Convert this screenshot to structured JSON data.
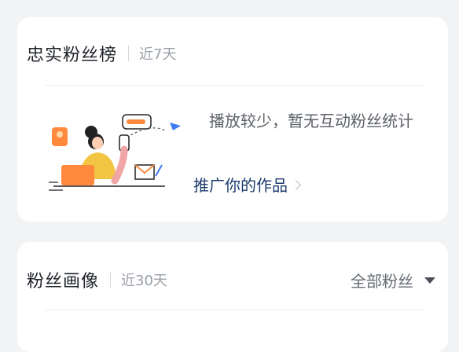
{
  "loyal_fans": {
    "title": "忠实粉丝榜",
    "period": "近7天",
    "empty_message": "播放较少，暂无互动粉丝统计",
    "promote_link": "推广你的作品"
  },
  "fan_profile": {
    "title": "粉丝画像",
    "period": "近30天",
    "filter_selected": "全部粉丝"
  },
  "icons": {
    "promote_chevron": "chevron-right-icon",
    "filter_caret": "caret-down-icon"
  },
  "colors": {
    "page_bg": "#f2f3f5",
    "card_bg": "#ffffff",
    "link": "#1d3c6e",
    "accent_orange": "#ff8a3d",
    "accent_yellow": "#f4c543",
    "accent_blue": "#3d7cf0"
  }
}
